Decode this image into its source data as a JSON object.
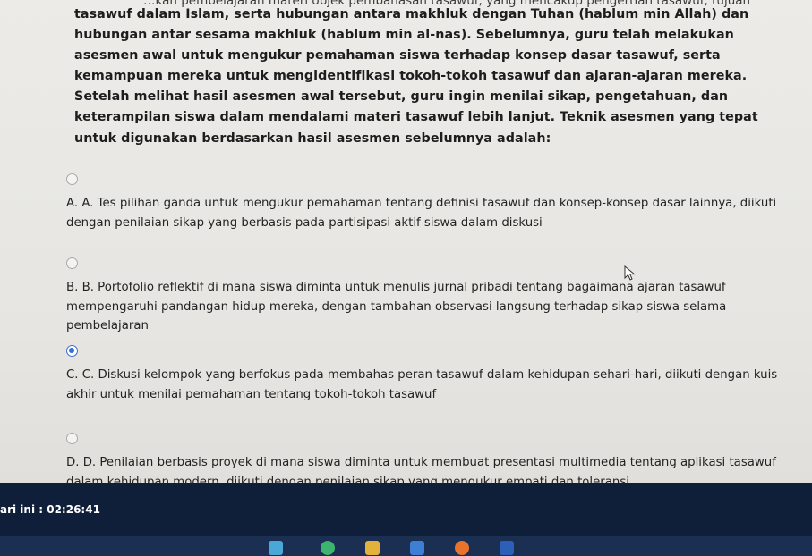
{
  "question": {
    "cutoff_line": "…kan pembelajaran materi objek pembahasan tasawuf, yang mencakup pengertian tasawuf, tujuan",
    "text": "tasawuf dalam Islam, serta hubungan antara makhluk dengan Tuhan (hablum min Allah) dan hubungan antar sesama makhluk (hablum min al-nas). Sebelumnya, guru telah melakukan asesmen awal untuk mengukur pemahaman siswa terhadap konsep dasar tasawuf, serta kemampuan mereka untuk mengidentifikasi tokoh-tokoh tasawuf dan ajaran-ajaran mereka. Setelah melihat hasil asesmen awal tersebut, guru ingin menilai sikap, pengetahuan, dan keterampilan siswa dalam mendalami materi tasawuf lebih lanjut. Teknik asesmen yang tepat untuk digunakan berdasarkan hasil asesmen sebelumnya adalah:"
  },
  "options": [
    {
      "text": "A. A. Tes pilihan ganda untuk mengukur pemahaman tentang definisi tasawuf dan konsep-konsep dasar lainnya, diikuti dengan penilaian sikap yang berbasis pada partisipasi aktif siswa dalam diskusi",
      "selected": false
    },
    {
      "text": "B. B. Portofolio reflektif di mana siswa diminta untuk menulis jurnal pribadi tentang bagaimana ajaran tasawuf mempengaruhi pandangan hidup mereka, dengan tambahan observasi langsung terhadap sikap siswa selama pembelajaran",
      "selected": false
    },
    {
      "text": "C. C. Diskusi kelompok yang berfokus pada membahas peran tasawuf dalam kehidupan sehari-hari, diikuti dengan kuis akhir untuk menilai pemahaman tentang tokoh-tokoh tasawuf",
      "selected": true
    },
    {
      "text": "D. D. Penilaian berbasis proyek di mana siswa diminta untuk membuat presentasi multimedia tentang aplikasi tasawuf dalam kehidupan modern, diikuti dengan penilaian sikap yang mengukur empati dan toleransi",
      "selected": false
    }
  ],
  "timer": {
    "text": "ari ini : 02:26:41"
  },
  "colors": {
    "accent": "#3b6fd6",
    "timer_bar": "#0f1f3a",
    "taskbar": "#1a2f52"
  },
  "taskbar": {
    "icons": [
      "app-icon",
      "chrome-icon",
      "folder-icon",
      "office-icon",
      "browser-icon",
      "word-icon"
    ]
  }
}
